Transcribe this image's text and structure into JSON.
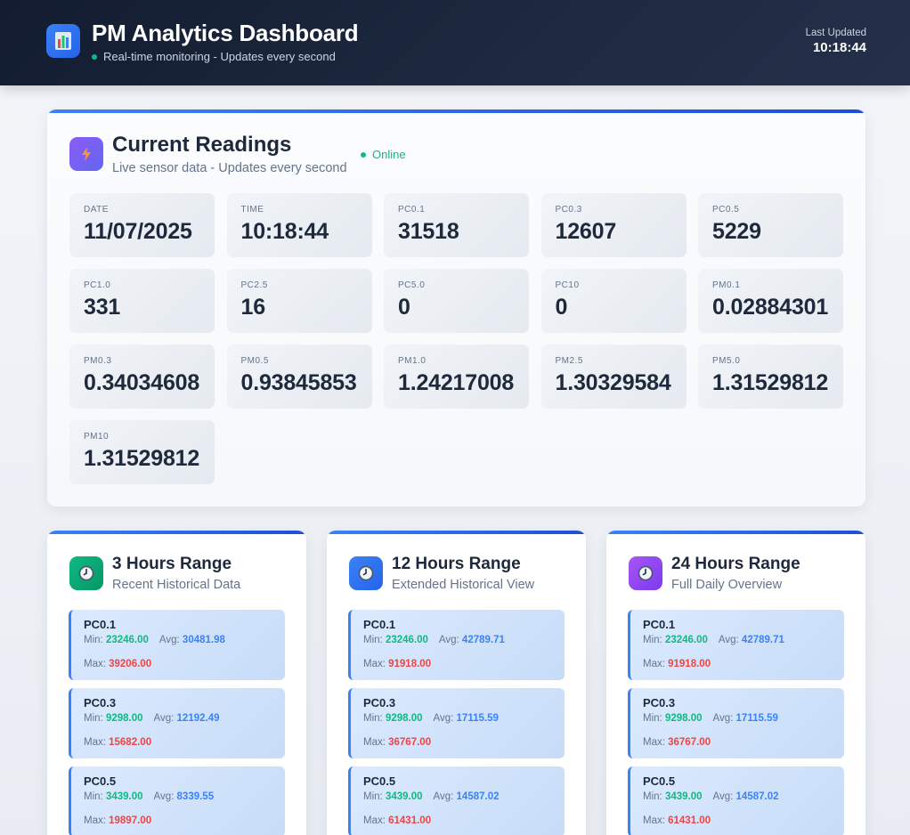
{
  "header": {
    "title": "PM Analytics Dashboard",
    "subtitle": "Real-time monitoring - Updates every second",
    "updated_label": "Last Updated",
    "updated_time": "10:18:44"
  },
  "current": {
    "title": "Current Readings",
    "subtitle": "Live sensor data - Updates every second",
    "status": "Online",
    "tiles": [
      {
        "label": "DATE",
        "value": "11/07/2025"
      },
      {
        "label": "TIME",
        "value": "10:18:44"
      },
      {
        "label": "PC0.1",
        "value": "31518"
      },
      {
        "label": "PC0.3",
        "value": "12607"
      },
      {
        "label": "PC0.5",
        "value": "5229"
      },
      {
        "label": "PC1.0",
        "value": "331"
      },
      {
        "label": "PC2.5",
        "value": "16"
      },
      {
        "label": "PC5.0",
        "value": "0"
      },
      {
        "label": "PC10",
        "value": "0"
      },
      {
        "label": "PM0.1",
        "value": "0.02884301"
      },
      {
        "label": "PM0.3",
        "value": "0.34034608"
      },
      {
        "label": "PM0.5",
        "value": "0.93845853"
      },
      {
        "label": "PM1.0",
        "value": "1.24217008"
      },
      {
        "label": "PM2.5",
        "value": "1.30329584"
      },
      {
        "label": "PM5.0",
        "value": "1.31529812"
      },
      {
        "label": "PM10",
        "value": "1.31529812"
      }
    ]
  },
  "labels": {
    "min": "Min:",
    "avg": "Avg:",
    "max": "Max:"
  },
  "ranges": [
    {
      "title": "3 Hours Range",
      "subtitle": "Recent Historical Data",
      "icon": "clock-icon",
      "metrics": [
        {
          "name": "PC0.1",
          "min": "23246.00",
          "avg": "30481.98",
          "max": "39206.00"
        },
        {
          "name": "PC0.3",
          "min": "9298.00",
          "avg": "12192.49",
          "max": "15682.00"
        },
        {
          "name": "PC0.5",
          "min": "3439.00",
          "avg": "8339.55",
          "max": "19897.00"
        }
      ]
    },
    {
      "title": "12 Hours Range",
      "subtitle": "Extended Historical View",
      "icon": "clock-icon",
      "metrics": [
        {
          "name": "PC0.1",
          "min": "23246.00",
          "avg": "42789.71",
          "max": "91918.00"
        },
        {
          "name": "PC0.3",
          "min": "9298.00",
          "avg": "17115.59",
          "max": "36767.00"
        },
        {
          "name": "PC0.5",
          "min": "3439.00",
          "avg": "14587.02",
          "max": "61431.00"
        }
      ]
    },
    {
      "title": "24 Hours Range",
      "subtitle": "Full Daily Overview",
      "icon": "clock-icon",
      "metrics": [
        {
          "name": "PC0.1",
          "min": "23246.00",
          "avg": "42789.71",
          "max": "91918.00"
        },
        {
          "name": "PC0.3",
          "min": "9298.00",
          "avg": "17115.59",
          "max": "36767.00"
        },
        {
          "name": "PC0.5",
          "min": "3439.00",
          "avg": "14587.02",
          "max": "61431.00"
        }
      ]
    }
  ],
  "colors": {
    "accent": "#3b82f6",
    "online": "#10b981",
    "min": "#10b981",
    "avg": "#3b82f6",
    "max": "#ef4444"
  }
}
